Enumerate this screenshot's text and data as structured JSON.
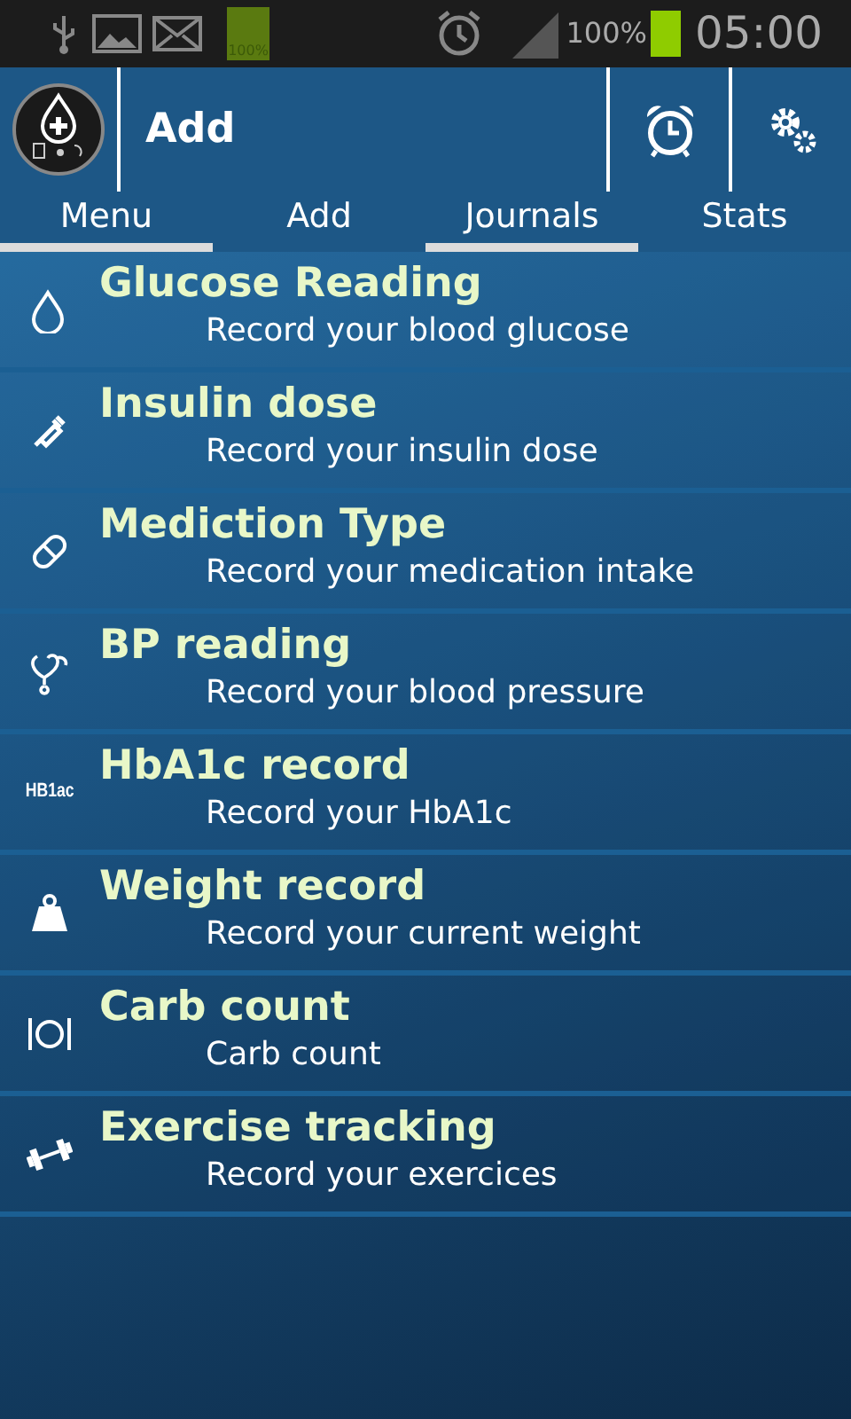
{
  "status_bar": {
    "battery_small_label": "100%",
    "battery_percent": "100%",
    "time": "05:00"
  },
  "action_bar": {
    "title": "Add"
  },
  "tabs": [
    {
      "label": "Menu",
      "underlined": true
    },
    {
      "label": "Add",
      "underlined": false
    },
    {
      "label": "Journals",
      "underlined": true
    },
    {
      "label": "Stats",
      "underlined": false
    }
  ],
  "items": [
    {
      "kind": "drop",
      "title": "Glucose Reading",
      "subtitle": "Record your blood glucose"
    },
    {
      "kind": "syringe",
      "title": "Insulin dose",
      "subtitle": "Record your insulin dose"
    },
    {
      "kind": "pill",
      "title": "Mediction Type",
      "subtitle": "Record your medication intake"
    },
    {
      "kind": "stethoscope",
      "title": "BP reading",
      "subtitle": "Record your blood pressure"
    },
    {
      "kind": "label",
      "icon_text": "HB1ac",
      "title": "HbA1c record",
      "subtitle": "Record your HbA1c"
    },
    {
      "kind": "weight",
      "title": "Weight record",
      "subtitle": "Record your current weight"
    },
    {
      "kind": "plate",
      "title": "Carb count",
      "subtitle": "Carb count"
    },
    {
      "kind": "dumbbell",
      "title": "Exercise tracking",
      "subtitle": "Record your exercices"
    }
  ]
}
